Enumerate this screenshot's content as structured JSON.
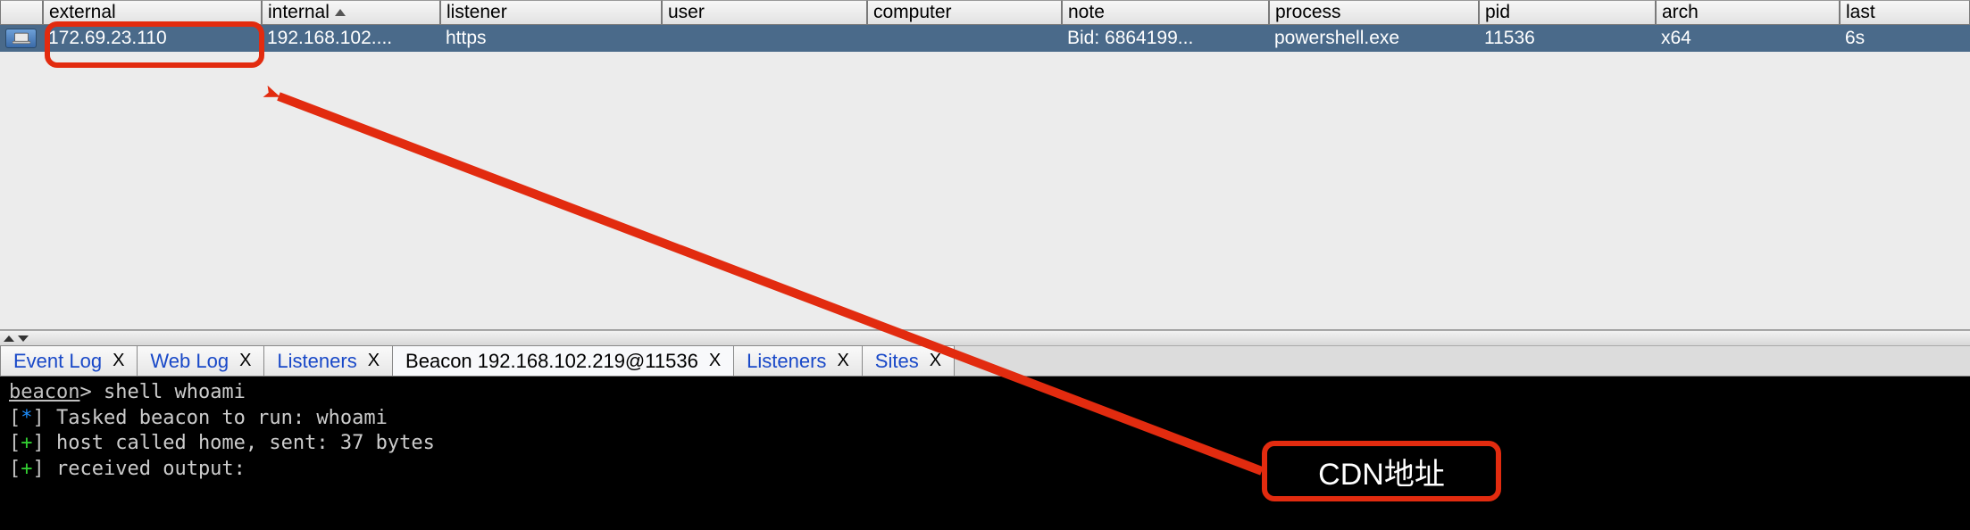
{
  "table": {
    "headers": {
      "external": "external",
      "internal": "internal",
      "listener": "listener",
      "user": "user",
      "computer": "computer",
      "note": "note",
      "process": "process",
      "pid": "pid",
      "arch": "arch",
      "last": "last"
    },
    "sorted_column": "internal",
    "rows": [
      {
        "external": "172.69.23.110",
        "internal": "192.168.102....",
        "listener": "https",
        "user": "",
        "computer": "",
        "note": "Bid: 6864199...",
        "process": "powershell.exe",
        "pid": "11536",
        "arch": "x64",
        "last": "6s"
      }
    ]
  },
  "tabs": [
    {
      "label": "Event Log",
      "active": false,
      "linkstyle": true
    },
    {
      "label": "Web Log",
      "active": false,
      "linkstyle": true
    },
    {
      "label": "Listeners",
      "active": false,
      "linkstyle": true
    },
    {
      "label": "Beacon 192.168.102.219@11536",
      "active": true,
      "linkstyle": false
    },
    {
      "label": "Listeners",
      "active": false,
      "linkstyle": true
    },
    {
      "label": "Sites",
      "active": false,
      "linkstyle": true
    }
  ],
  "console": {
    "prompt_label": "beacon",
    "prompt_symbol": ">",
    "command": "shell whoami",
    "lines": [
      {
        "sym": "*",
        "text": "Tasked beacon to run: whoami"
      },
      {
        "sym": "+",
        "text": "host called home, sent: 37 bytes"
      },
      {
        "sym": "+",
        "text": "received output:"
      }
    ]
  },
  "annotations": {
    "label_text": "CDN地址",
    "arrow_color": "#e22b0f"
  }
}
